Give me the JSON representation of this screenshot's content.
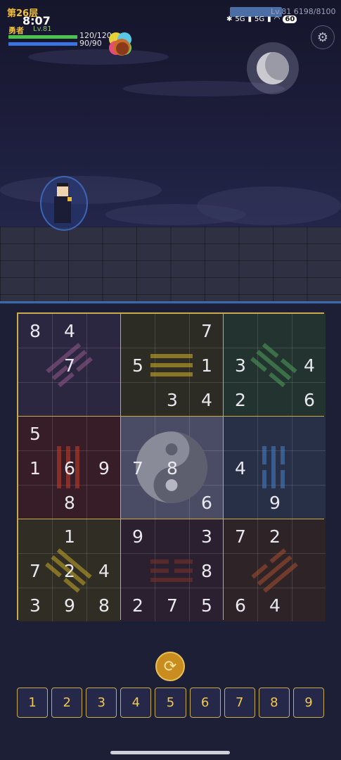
{
  "hud": {
    "floor": "第26层",
    "time": "8:07",
    "hero_name": "勇者",
    "hero_level": "Lv.81",
    "hp_text": "120/120",
    "mp_text": "90/90",
    "hp_fraction": 1.0,
    "mp_fraction": 1.0,
    "xp_text": "Lv.81 6198/8100",
    "battery": "60",
    "net1": "5G",
    "net2": "5G"
  },
  "board": {
    "rows": [
      [
        "8",
        "4",
        "",
        "",
        "",
        "7",
        "",
        "",
        ""
      ],
      [
        "",
        "7",
        "",
        "5",
        "",
        "1",
        "3",
        "",
        "4"
      ],
      [
        "",
        "",
        "",
        "",
        "3",
        "4",
        "2",
        "",
        "6"
      ],
      [
        "5",
        "",
        "",
        "",
        "",
        "",
        "",
        "",
        ""
      ],
      [
        "1",
        "6",
        "9",
        "7",
        "8",
        "",
        "4",
        "",
        ""
      ],
      [
        "",
        "8",
        "",
        "",
        "",
        "6",
        "",
        "9",
        ""
      ],
      [
        "",
        "1",
        "",
        "9",
        "",
        "3",
        "7",
        "2",
        ""
      ],
      [
        "7",
        "2",
        "4",
        "",
        "",
        "8",
        "",
        "",
        ""
      ],
      [
        "3",
        "9",
        "8",
        "2",
        "7",
        "5",
        "6",
        "4",
        ""
      ]
    ],
    "box_colors": [
      "#2c2741",
      "#2c2b24",
      "#233330",
      "#361d27",
      "#4a4c66",
      "#283048",
      "#2f2d24",
      "#2a2030",
      "#2e2326"
    ]
  },
  "numpad": [
    "1",
    "2",
    "3",
    "4",
    "5",
    "6",
    "7",
    "8",
    "9"
  ],
  "icons": {
    "settings": "gear-icon",
    "refresh": "refresh-icon",
    "moon": "moon-icon"
  }
}
